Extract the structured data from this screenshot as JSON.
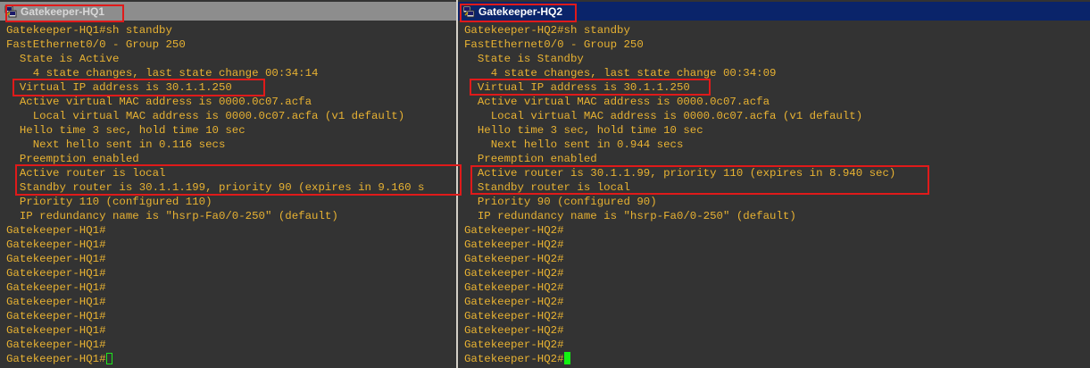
{
  "windows": {
    "hq1": {
      "title": "Gatekeeper-HQ1",
      "lines": [
        "Gatekeeper-HQ1#sh standby",
        "FastEthernet0/0 - Group 250",
        "  State is Active",
        "    4 state changes, last state change 00:34:14",
        "  Virtual IP address is 30.1.1.250",
        "  Active virtual MAC address is 0000.0c07.acfa",
        "    Local virtual MAC address is 0000.0c07.acfa (v1 default)",
        "  Hello time 3 sec, hold time 10 sec",
        "    Next hello sent in 0.116 secs",
        "  Preemption enabled",
        "  Active router is local",
        "  Standby router is 30.1.1.199, priority 90 (expires in 9.160 s",
        "  Priority 110 (configured 110)",
        "  IP redundancy name is \"hsrp-Fa0/0-250\" (default)",
        "Gatekeeper-HQ1#",
        "Gatekeeper-HQ1#",
        "Gatekeeper-HQ1#",
        "Gatekeeper-HQ1#",
        "Gatekeeper-HQ1#",
        "Gatekeeper-HQ1#",
        "Gatekeeper-HQ1#",
        "Gatekeeper-HQ1#",
        "Gatekeeper-HQ1#"
      ],
      "prompt": "Gatekeeper-HQ1#"
    },
    "hq2": {
      "title": "Gatekeeper-HQ2",
      "lines": [
        "Gatekeeper-HQ2#sh standby",
        "FastEthernet0/0 - Group 250",
        "  State is Standby",
        "    4 state changes, last state change 00:34:09",
        "  Virtual IP address is 30.1.1.250",
        "  Active virtual MAC address is 0000.0c07.acfa",
        "    Local virtual MAC address is 0000.0c07.acfa (v1 default)",
        "  Hello time 3 sec, hold time 10 sec",
        "    Next hello sent in 0.944 secs",
        "  Preemption enabled",
        "  Active router is 30.1.1.99, priority 110 (expires in 8.940 sec)",
        "  Standby router is local",
        "  Priority 90 (configured 90)",
        "  IP redundancy name is \"hsrp-Fa0/0-250\" (default)",
        "Gatekeeper-HQ2#",
        "Gatekeeper-HQ2#",
        "Gatekeeper-HQ2#",
        "Gatekeeper-HQ2#",
        "Gatekeeper-HQ2#",
        "Gatekeeper-HQ2#",
        "Gatekeeper-HQ2#",
        "Gatekeeper-HQ2#",
        "Gatekeeper-HQ2#"
      ],
      "prompt": "Gatekeeper-HQ2#"
    }
  },
  "icons": {
    "app_icon": "putty-terminal-icon"
  },
  "colors": {
    "terminal_background": "#333333",
    "terminal_text": "#e8b232",
    "cursor": "#12f212",
    "highlight_box": "#e01a1a",
    "active_titlebar": "#0a246a",
    "inactive_titlebar": "#8d8d8d"
  }
}
